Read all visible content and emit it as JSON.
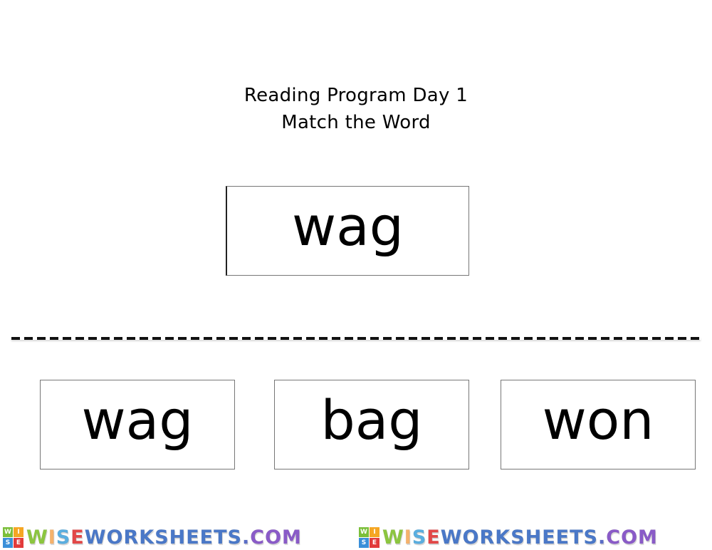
{
  "worksheet": {
    "title_line1": "Reading Program Day 1",
    "title_line2": "Match the Word",
    "target_word": "wag",
    "options": [
      "wag",
      "bag",
      "won"
    ]
  },
  "branding": {
    "tiles": [
      {
        "letter": "W",
        "color": "#7bbf3a"
      },
      {
        "letter": "I",
        "color": "#f5a623"
      },
      {
        "letter": "S",
        "color": "#3a8fd9"
      },
      {
        "letter": "E",
        "color": "#e23b3b"
      }
    ],
    "wordmark_parts": [
      {
        "text": "W",
        "color": "#8cc63f"
      },
      {
        "text": "I",
        "color": "#f6b26b"
      },
      {
        "text": "S",
        "color": "#5aaee0"
      },
      {
        "text": "E",
        "color": "#e34848"
      },
      {
        "text": "WORKSHEETS",
        "color": "#4a78c8"
      },
      {
        "text": ".",
        "color": "#5a6ec8"
      },
      {
        "text": "COM",
        "color": "#8a5bc8"
      }
    ]
  }
}
